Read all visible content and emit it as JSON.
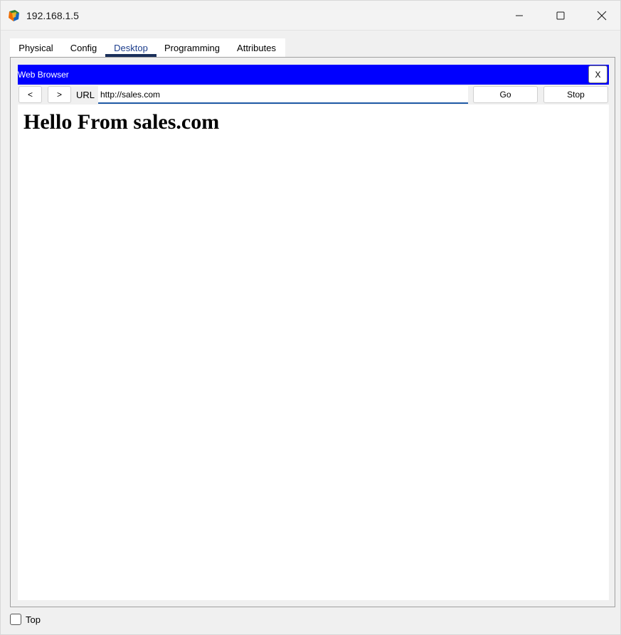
{
  "window": {
    "title": "192.168.1.5"
  },
  "tabs": [
    {
      "label": "Physical"
    },
    {
      "label": "Config"
    },
    {
      "label": "Desktop",
      "active": true
    },
    {
      "label": "Programming"
    },
    {
      "label": "Attributes"
    }
  ],
  "browser": {
    "title": "Web Browser",
    "close_label": "X",
    "back_label": "<",
    "forward_label": ">",
    "url_label": "URL",
    "url_value": "http://sales.com",
    "go_label": "Go",
    "stop_label": "Stop",
    "page_heading": "Hello From sales.com"
  },
  "footer": {
    "top_label": "Top",
    "top_checked": false
  },
  "colors": {
    "browser_header": "#0000ff",
    "active_tab_indicator": "#1a2f5a",
    "url_underline": "#1f5aa6"
  }
}
